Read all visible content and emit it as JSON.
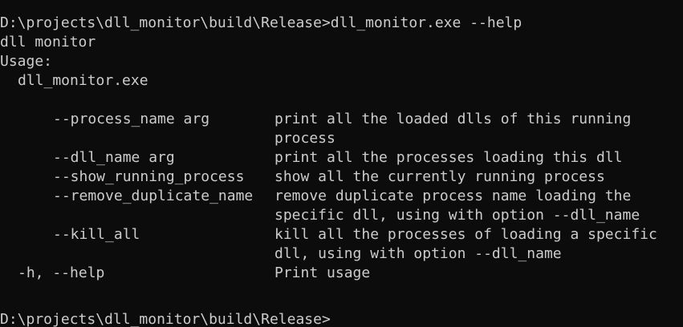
{
  "console": {
    "prompt_line": "D:\\projects\\dll_monitor\\build\\Release>dll_monitor.exe --help",
    "program_name": "dll monitor",
    "usage_label": "Usage:",
    "usage_command": "dll_monitor.exe",
    "options": [
      {
        "flag": "--process_name arg",
        "desc_lines": [
          "print all the loaded dlls of this running",
          "process"
        ]
      },
      {
        "flag": "--dll_name arg",
        "desc_lines": [
          "print all the processes loading this dll"
        ]
      },
      {
        "flag": "--show_running_process",
        "desc_lines": [
          "show all the currently running process"
        ]
      },
      {
        "flag": "--remove_duplicate_name",
        "desc_lines": [
          "remove duplicate process name loading the",
          "specific dll, using with option --dll_name"
        ]
      },
      {
        "flag": "--kill_all",
        "desc_lines": [
          "kill all the processes of loading a specific",
          "dll, using with option --dll_name"
        ]
      },
      {
        "flag": "-h, --help",
        "desc_lines": [
          "Print usage"
        ]
      }
    ],
    "next_prompt_partial": "D:\\projects\\dll_monitor\\build\\Release>"
  }
}
